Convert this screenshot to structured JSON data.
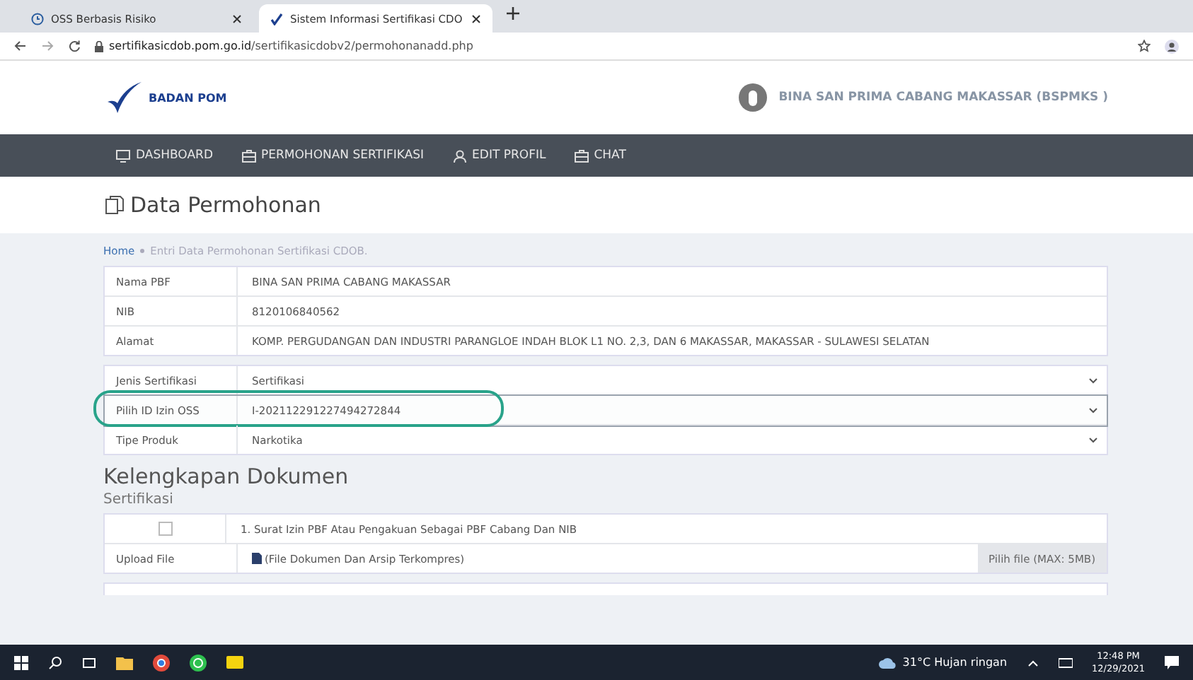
{
  "browser": {
    "tabs": [
      {
        "title": "OSS Berbasis Risiko",
        "selected": false
      },
      {
        "title": "Sistem Informasi Sertifikasi CDO",
        "selected": true
      }
    ],
    "url_host": "sertifikasicdob.pom.go.id",
    "url_path": "/sertifikasicdobv2/permohonanadd.php"
  },
  "header": {
    "logo_text": "BADAN POM",
    "user": "BINA SAN PRIMA CABANG MAKASSAR (BSPMKS )"
  },
  "nav": [
    {
      "label": "DASHBOARD"
    },
    {
      "label": "PERMOHONAN SERTIFIKASI"
    },
    {
      "label": "EDIT PROFIL"
    },
    {
      "label": "CHAT"
    }
  ],
  "page_title": "Data Permohonan",
  "breadcrumb": {
    "home": "Home",
    "current": "Entri Data Permohonan Sertifikasi CDOB."
  },
  "info_rows": [
    {
      "label": "Nama PBF",
      "value": "BINA SAN PRIMA CABANG MAKASSAR"
    },
    {
      "label": "NIB",
      "value": "8120106840562"
    },
    {
      "label": "Alamat",
      "value": "KOMP. PERGUDANGAN DAN INDUSTRI PARANGLOE INDAH BLOK L1 NO. 2,3, DAN 6 MAKASSAR, MAKASSAR - SULAWESI SELATAN"
    }
  ],
  "select_rows": [
    {
      "label": "Jenis Sertifikasi",
      "value": "Sertifikasi",
      "highlighted": false
    },
    {
      "label": "Pilih ID Izin OSS",
      "value": "I-202112291227494272844",
      "highlighted": true
    },
    {
      "label": "Tipe Produk",
      "value": "Narkotika",
      "highlighted": false
    }
  ],
  "documents_heading": "Kelengkapan Dokumen",
  "documents_subheading": "Sertifikasi",
  "documents": [
    {
      "title": "1. Surat Izin PBF Atau Pengakuan Sebagai PBF Cabang Dan NIB",
      "checked": false,
      "upload_label": "Upload File",
      "file_placeholder": "(File Dokumen Dan Arsip Terkompres)",
      "button": "Pilih file (MAX: 5MB)"
    }
  ],
  "taskbar": {
    "weather": "31°C  Hujan ringan",
    "time": "12:48 PM",
    "date": "12/29/2021"
  }
}
